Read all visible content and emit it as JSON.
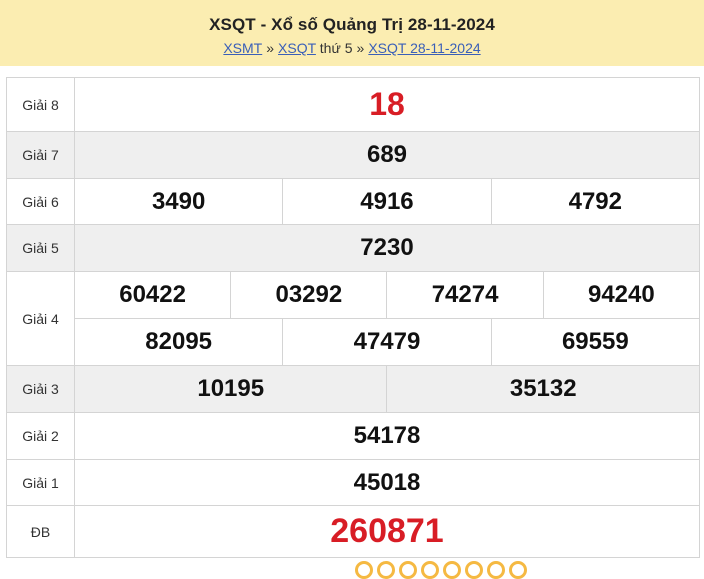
{
  "header": {
    "title": "XSQT - Xổ số Quảng Trị 28-11-2024",
    "breadcrumb": {
      "link1": "XSMT",
      "sep1": "»",
      "link2": "XSQT",
      "text2": "thứ 5",
      "sep2": "»",
      "link3": "XSQT 28-11-2024"
    }
  },
  "prizes": {
    "g8": {
      "label": "Giải 8",
      "numbers": [
        "18"
      ]
    },
    "g7": {
      "label": "Giải 7",
      "numbers": [
        "689"
      ]
    },
    "g6": {
      "label": "Giải 6",
      "numbers": [
        "3490",
        "4916",
        "4792"
      ]
    },
    "g5": {
      "label": "Giải 5",
      "numbers": [
        "7230"
      ]
    },
    "g4": {
      "label": "Giải 4",
      "numbers": [
        "60422",
        "03292",
        "74274",
        "94240",
        "82095",
        "47479",
        "69559"
      ]
    },
    "g3": {
      "label": "Giải 3",
      "numbers": [
        "10195",
        "35132"
      ]
    },
    "g2": {
      "label": "Giải 2",
      "numbers": [
        "54178"
      ]
    },
    "g1": {
      "label": "Giải 1",
      "numbers": [
        "45018"
      ]
    },
    "db": {
      "label": "ĐB",
      "numbers": [
        "260871"
      ]
    }
  },
  "colors": {
    "header_bg": "#fbedb1",
    "accent_red": "#d81d25",
    "link_blue": "#3a5fb8",
    "alt_row": "#efefef"
  }
}
